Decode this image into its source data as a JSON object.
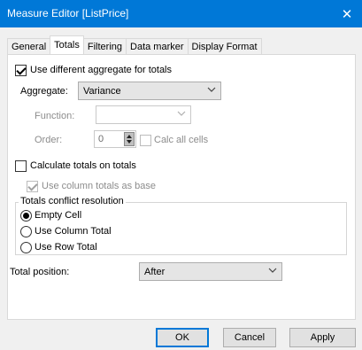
{
  "window": {
    "title": "Measure Editor [ListPrice]",
    "close_glyph": "✕"
  },
  "tabs": [
    {
      "label": "General",
      "active": false
    },
    {
      "label": "Totals",
      "active": true
    },
    {
      "label": "Filtering",
      "active": false
    },
    {
      "label": "Data marker",
      "active": false
    },
    {
      "label": "Display Format",
      "active": false
    }
  ],
  "totals": {
    "use_diff_aggregate": {
      "label": "Use different aggregate for totals",
      "checked": true
    },
    "aggregate": {
      "label": "Aggregate:",
      "value": "Variance"
    },
    "function": {
      "label": "Function:",
      "value": ""
    },
    "order": {
      "label": "Order:",
      "value": "0"
    },
    "calc_all_cells": {
      "label": "Calc all cells",
      "checked": false
    },
    "calc_totals_on_totals": {
      "label": "Calculate totals on totals",
      "checked": false
    },
    "use_column_totals": {
      "label": "Use column totals as base",
      "checked": true
    },
    "conflict_group": {
      "label": "Totals conflict resolution",
      "options": [
        {
          "label": "Empty Cell",
          "checked": true
        },
        {
          "label": "Use Column Total",
          "checked": false
        },
        {
          "label": "Use Row Total",
          "checked": false
        }
      ]
    },
    "total_position": {
      "label": "Total position:",
      "value": "After"
    }
  },
  "buttons": {
    "ok": "OK",
    "cancel": "Cancel",
    "apply": "Apply"
  }
}
